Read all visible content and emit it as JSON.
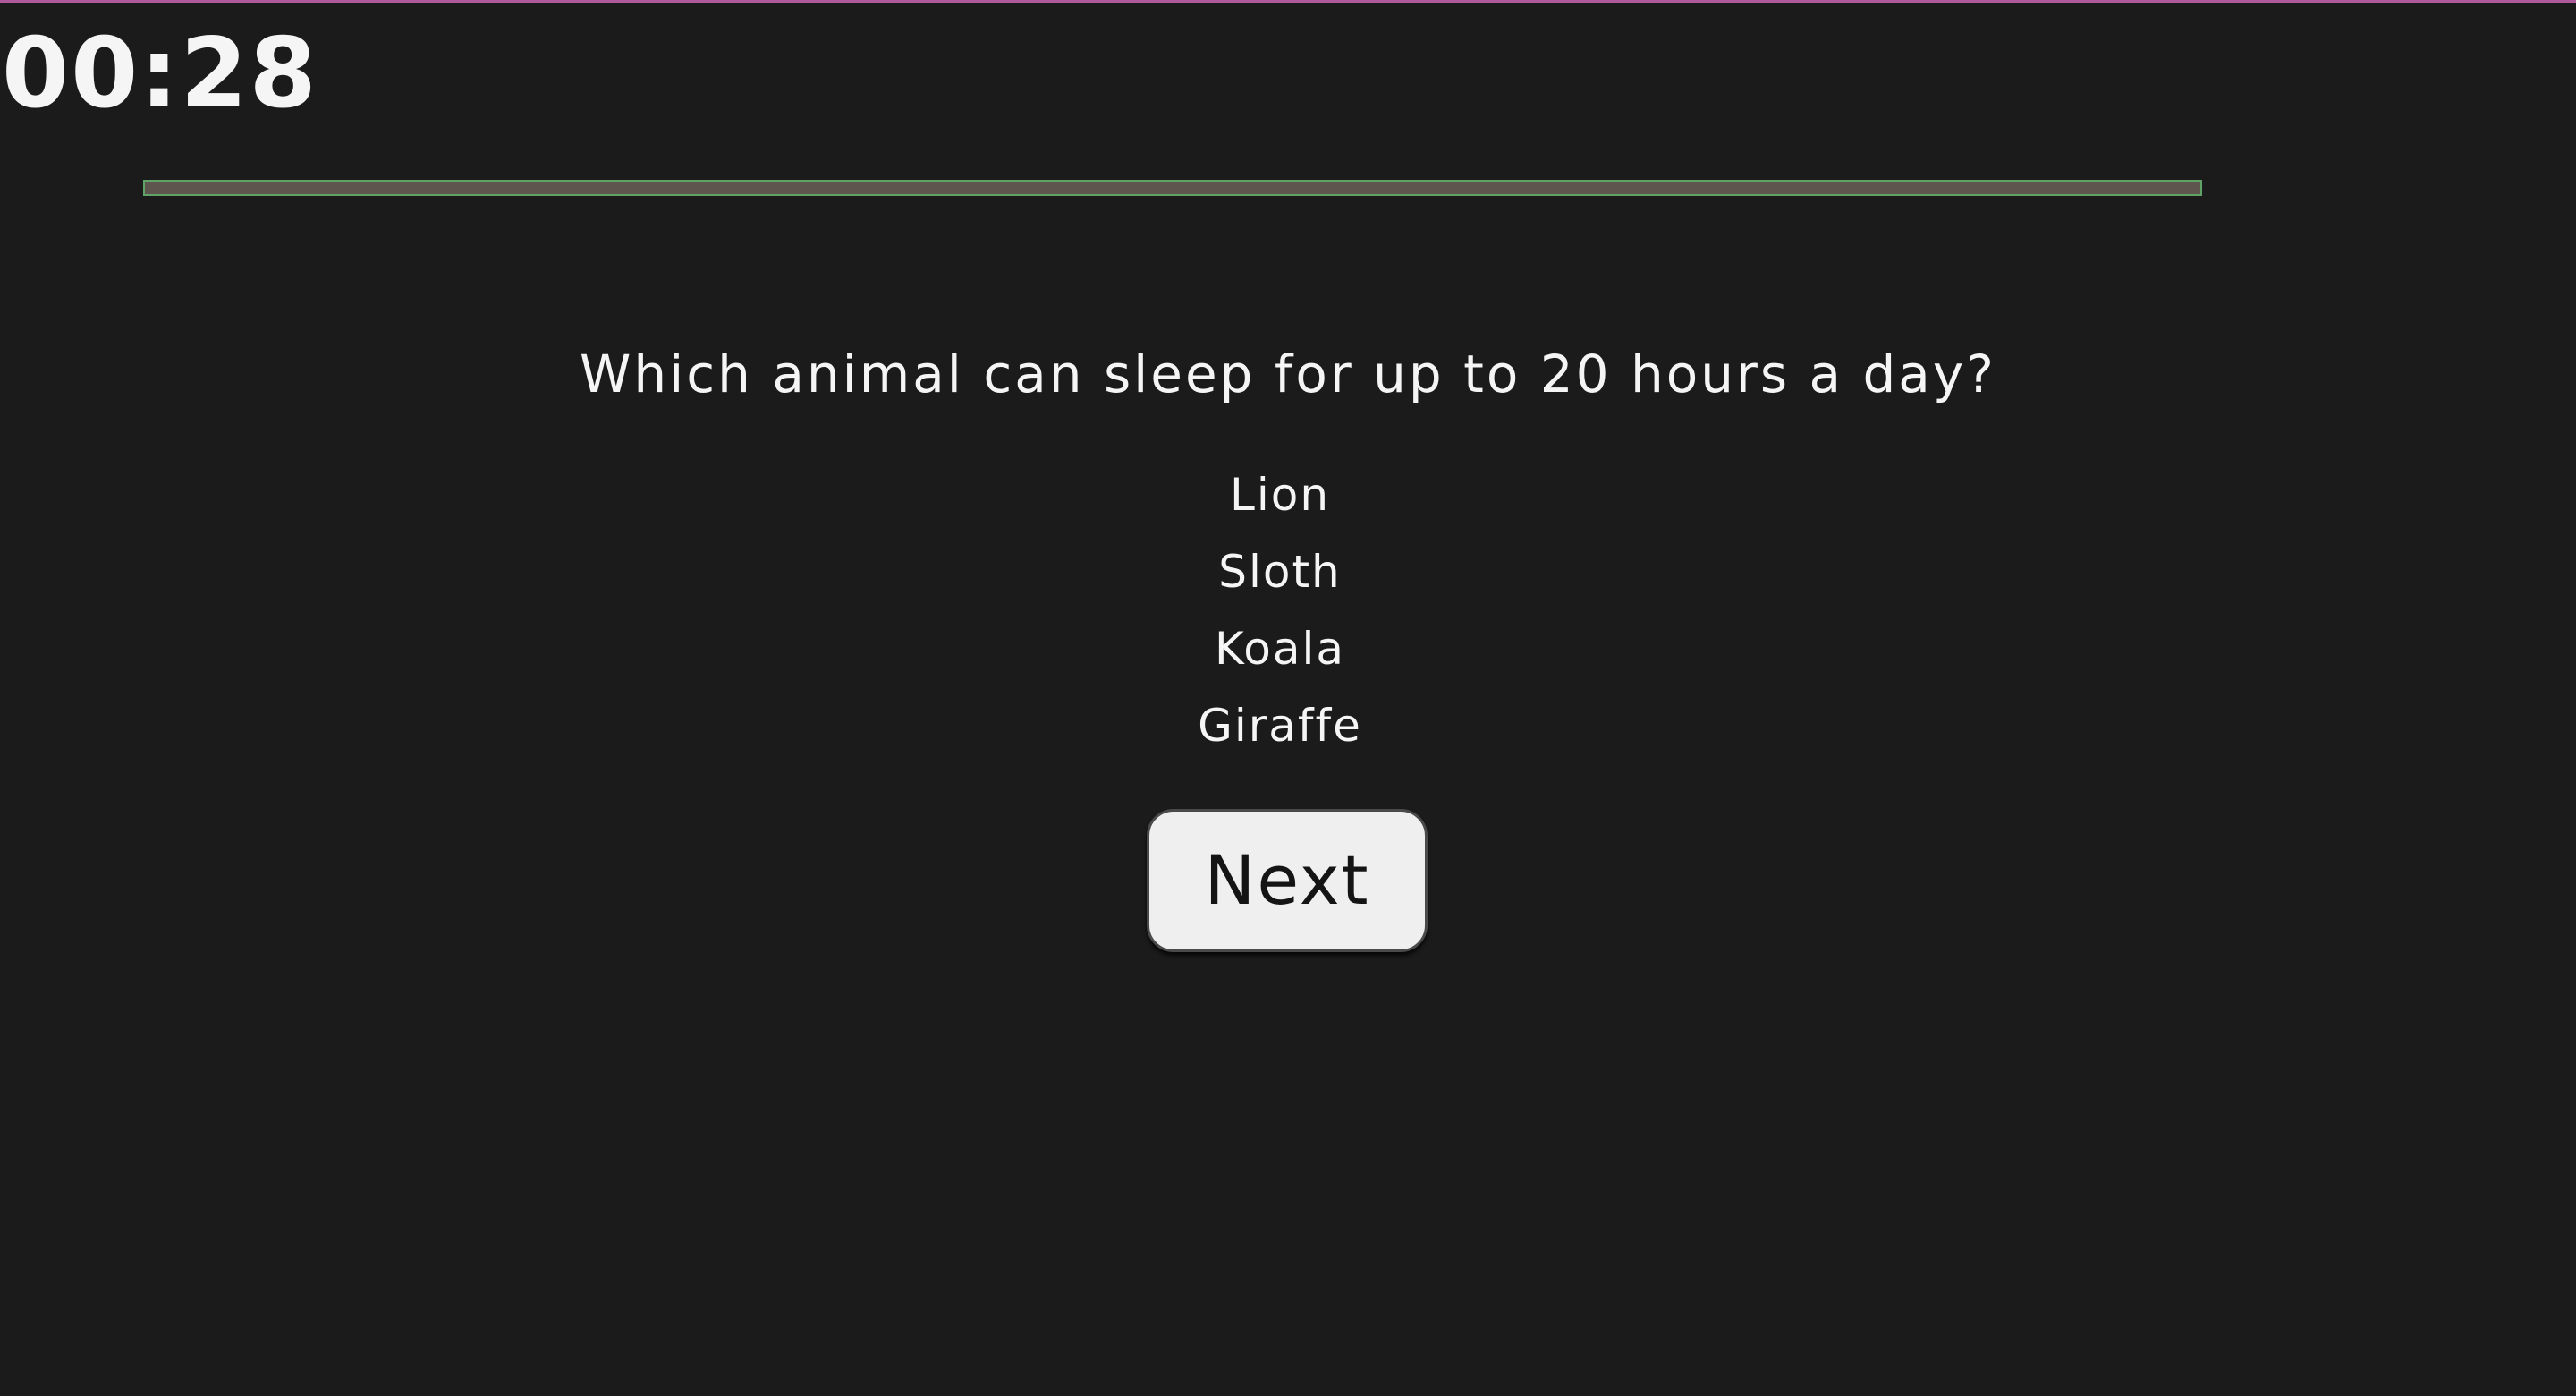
{
  "timer": {
    "text": "00:28"
  },
  "progress": {
    "fraction": 0.0,
    "track_color": "#5e554f",
    "border_color": "#5fa466"
  },
  "quiz": {
    "question": "Which animal can sleep for up to 20 hours a day?",
    "options": [
      "Lion",
      "Sloth",
      "Koala",
      "Giraffe"
    ],
    "next_label": "Next"
  },
  "colors": {
    "background": "#1c1b1b",
    "text": "#f5f5f5",
    "button_bg": "#efefef",
    "top_border": "#b05a9c"
  }
}
